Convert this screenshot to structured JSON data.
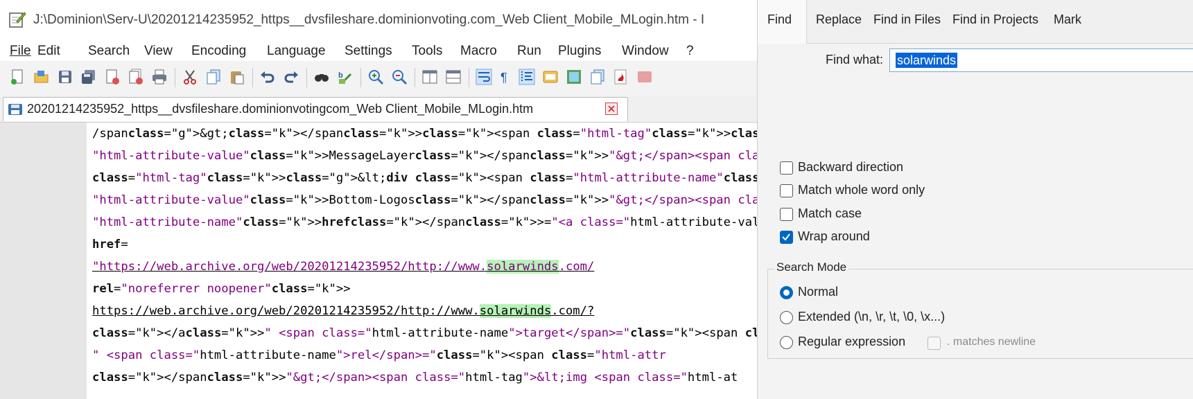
{
  "window": {
    "title": "J:\\Dominion\\Serv-U\\20201214235952_https__dvsfileshare.dominionvoting.com_Web Client_Mobile_MLogin.htm - I"
  },
  "menu": [
    {
      "label": "File"
    },
    {
      "label": "Edit"
    },
    {
      "label": "Search"
    },
    {
      "label": "View"
    },
    {
      "label": "Encoding"
    },
    {
      "label": "Language"
    },
    {
      "label": "Settings"
    },
    {
      "label": "Tools"
    },
    {
      "label": "Macro"
    },
    {
      "label": "Run"
    },
    {
      "label": "Plugins"
    },
    {
      "label": "Window"
    },
    {
      "label": "?"
    }
  ],
  "toolbar_icons": [
    "new-file-icon",
    "open-file-icon",
    "save-icon",
    "save-all-icon",
    "close-icon",
    "close-all-icon",
    "print-icon",
    "cut-icon",
    "copy-icon",
    "paste-icon",
    "undo-icon",
    "redo-icon",
    "find-icon",
    "replace-icon",
    "zoom-in-icon",
    "zoom-out-icon",
    "sync-vertical-icon",
    "sync-horizontal-icon",
    "word-wrap-icon",
    "show-all-chars-icon",
    "indent-guide-icon",
    "udl-icon",
    "document-map-icon",
    "function-list-icon",
    "folder-as-workspace-icon",
    "monitoring-icon"
  ],
  "document_tab": {
    "label": "20201214235952_https__dvsfileshare.dominionvotingcom_Web Client_Mobile_MLogin.htm"
  },
  "code_lines": [
    "/span&gt;</span><span class=\"html-tag\">&lt;div <span class=\"html-attrik",
    "\"html-attribute-value\">MessageLayer</span>\"&gt;</span><span class=\"html",
    "class=\"html-tag\">&lt;div <span class=\"html-attribute-name\">class</span",
    "\"html-attribute-value\">Bottom-Logos</span>\"&gt;</span><span class=\"html",
    "\"html-attribute-name\">href</span>=\"<a class=\"html-attribute-value html-",
    "href=",
    "\"https://web.archive.org/web/20201214235952/http://www.solarwinds.com/",
    "rel=\"noreferrer noopener\">",
    "https://web.archive.org/web/20201214235952/http://www.solarwinds.com/?",
    "</a>\" <span class=\"html-attribute-name\">target</span>=\"<span class=\"htm",
    "\" <span class=\"html-attribute-name\">rel</span>=\"<span class=\"html-attr",
    "</span>\"&gt;</span><span class=\"html-tag\">&lt;img <span class=\"html-at"
  ],
  "find_dialog": {
    "tabs": [
      {
        "label": "Find",
        "active": true
      },
      {
        "label": "Replace"
      },
      {
        "label": "Find in Files"
      },
      {
        "label": "Find in Projects"
      },
      {
        "label": "Mark"
      }
    ],
    "find_what_label": "Find what:",
    "find_what_value": "solarwinds",
    "options": [
      {
        "label": "Backward direction",
        "checked": false
      },
      {
        "label": "Match whole word only",
        "checked": false
      },
      {
        "label": "Match case",
        "checked": false
      },
      {
        "label": "Wrap around",
        "checked": true
      }
    ],
    "search_mode": {
      "title": "Search Mode",
      "modes": [
        {
          "label": "Normal",
          "selected": true
        },
        {
          "label": "Extended (\\n, \\r, \\t, \\0, \\x...)",
          "selected": false
        },
        {
          "label": "Regular expression",
          "selected": false
        }
      ],
      "matches_newline_label": ". matches newline"
    }
  },
  "colors": {
    "keyword_blue": "#0000ff",
    "string_purple": "#800080",
    "highlight_green": "#b7f2b7",
    "accent_blue": "#0067c0"
  }
}
